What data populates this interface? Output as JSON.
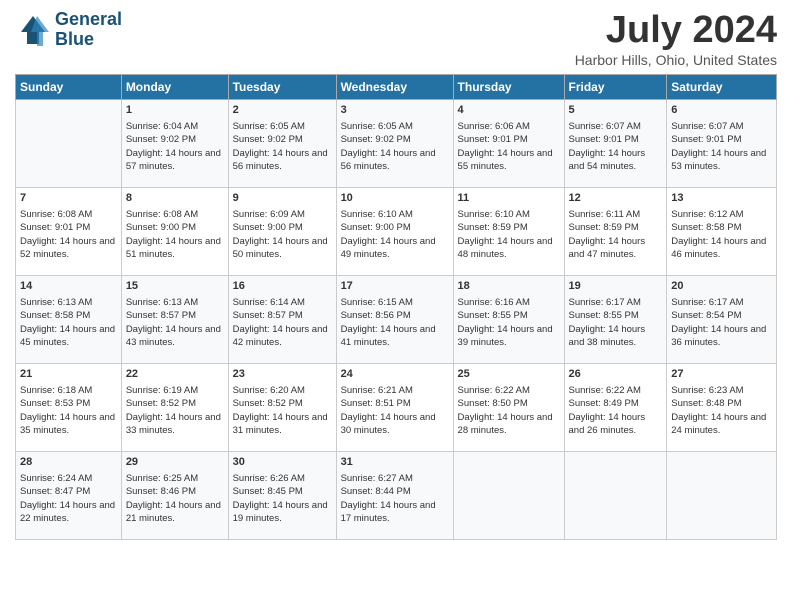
{
  "header": {
    "logo_line1": "General",
    "logo_line2": "Blue",
    "title": "July 2024",
    "location": "Harbor Hills, Ohio, United States"
  },
  "columns": [
    "Sunday",
    "Monday",
    "Tuesday",
    "Wednesday",
    "Thursday",
    "Friday",
    "Saturday"
  ],
  "weeks": [
    [
      {
        "day": "",
        "sunrise": "",
        "sunset": "",
        "daylight": ""
      },
      {
        "day": "1",
        "sunrise": "Sunrise: 6:04 AM",
        "sunset": "Sunset: 9:02 PM",
        "daylight": "Daylight: 14 hours and 57 minutes."
      },
      {
        "day": "2",
        "sunrise": "Sunrise: 6:05 AM",
        "sunset": "Sunset: 9:02 PM",
        "daylight": "Daylight: 14 hours and 56 minutes."
      },
      {
        "day": "3",
        "sunrise": "Sunrise: 6:05 AM",
        "sunset": "Sunset: 9:02 PM",
        "daylight": "Daylight: 14 hours and 56 minutes."
      },
      {
        "day": "4",
        "sunrise": "Sunrise: 6:06 AM",
        "sunset": "Sunset: 9:01 PM",
        "daylight": "Daylight: 14 hours and 55 minutes."
      },
      {
        "day": "5",
        "sunrise": "Sunrise: 6:07 AM",
        "sunset": "Sunset: 9:01 PM",
        "daylight": "Daylight: 14 hours and 54 minutes."
      },
      {
        "day": "6",
        "sunrise": "Sunrise: 6:07 AM",
        "sunset": "Sunset: 9:01 PM",
        "daylight": "Daylight: 14 hours and 53 minutes."
      }
    ],
    [
      {
        "day": "7",
        "sunrise": "Sunrise: 6:08 AM",
        "sunset": "Sunset: 9:01 PM",
        "daylight": "Daylight: 14 hours and 52 minutes."
      },
      {
        "day": "8",
        "sunrise": "Sunrise: 6:08 AM",
        "sunset": "Sunset: 9:00 PM",
        "daylight": "Daylight: 14 hours and 51 minutes."
      },
      {
        "day": "9",
        "sunrise": "Sunrise: 6:09 AM",
        "sunset": "Sunset: 9:00 PM",
        "daylight": "Daylight: 14 hours and 50 minutes."
      },
      {
        "day": "10",
        "sunrise": "Sunrise: 6:10 AM",
        "sunset": "Sunset: 9:00 PM",
        "daylight": "Daylight: 14 hours and 49 minutes."
      },
      {
        "day": "11",
        "sunrise": "Sunrise: 6:10 AM",
        "sunset": "Sunset: 8:59 PM",
        "daylight": "Daylight: 14 hours and 48 minutes."
      },
      {
        "day": "12",
        "sunrise": "Sunrise: 6:11 AM",
        "sunset": "Sunset: 8:59 PM",
        "daylight": "Daylight: 14 hours and 47 minutes."
      },
      {
        "day": "13",
        "sunrise": "Sunrise: 6:12 AM",
        "sunset": "Sunset: 8:58 PM",
        "daylight": "Daylight: 14 hours and 46 minutes."
      }
    ],
    [
      {
        "day": "14",
        "sunrise": "Sunrise: 6:13 AM",
        "sunset": "Sunset: 8:58 PM",
        "daylight": "Daylight: 14 hours and 45 minutes."
      },
      {
        "day": "15",
        "sunrise": "Sunrise: 6:13 AM",
        "sunset": "Sunset: 8:57 PM",
        "daylight": "Daylight: 14 hours and 43 minutes."
      },
      {
        "day": "16",
        "sunrise": "Sunrise: 6:14 AM",
        "sunset": "Sunset: 8:57 PM",
        "daylight": "Daylight: 14 hours and 42 minutes."
      },
      {
        "day": "17",
        "sunrise": "Sunrise: 6:15 AM",
        "sunset": "Sunset: 8:56 PM",
        "daylight": "Daylight: 14 hours and 41 minutes."
      },
      {
        "day": "18",
        "sunrise": "Sunrise: 6:16 AM",
        "sunset": "Sunset: 8:55 PM",
        "daylight": "Daylight: 14 hours and 39 minutes."
      },
      {
        "day": "19",
        "sunrise": "Sunrise: 6:17 AM",
        "sunset": "Sunset: 8:55 PM",
        "daylight": "Daylight: 14 hours and 38 minutes."
      },
      {
        "day": "20",
        "sunrise": "Sunrise: 6:17 AM",
        "sunset": "Sunset: 8:54 PM",
        "daylight": "Daylight: 14 hours and 36 minutes."
      }
    ],
    [
      {
        "day": "21",
        "sunrise": "Sunrise: 6:18 AM",
        "sunset": "Sunset: 8:53 PM",
        "daylight": "Daylight: 14 hours and 35 minutes."
      },
      {
        "day": "22",
        "sunrise": "Sunrise: 6:19 AM",
        "sunset": "Sunset: 8:52 PM",
        "daylight": "Daylight: 14 hours and 33 minutes."
      },
      {
        "day": "23",
        "sunrise": "Sunrise: 6:20 AM",
        "sunset": "Sunset: 8:52 PM",
        "daylight": "Daylight: 14 hours and 31 minutes."
      },
      {
        "day": "24",
        "sunrise": "Sunrise: 6:21 AM",
        "sunset": "Sunset: 8:51 PM",
        "daylight": "Daylight: 14 hours and 30 minutes."
      },
      {
        "day": "25",
        "sunrise": "Sunrise: 6:22 AM",
        "sunset": "Sunset: 8:50 PM",
        "daylight": "Daylight: 14 hours and 28 minutes."
      },
      {
        "day": "26",
        "sunrise": "Sunrise: 6:22 AM",
        "sunset": "Sunset: 8:49 PM",
        "daylight": "Daylight: 14 hours and 26 minutes."
      },
      {
        "day": "27",
        "sunrise": "Sunrise: 6:23 AM",
        "sunset": "Sunset: 8:48 PM",
        "daylight": "Daylight: 14 hours and 24 minutes."
      }
    ],
    [
      {
        "day": "28",
        "sunrise": "Sunrise: 6:24 AM",
        "sunset": "Sunset: 8:47 PM",
        "daylight": "Daylight: 14 hours and 22 minutes."
      },
      {
        "day": "29",
        "sunrise": "Sunrise: 6:25 AM",
        "sunset": "Sunset: 8:46 PM",
        "daylight": "Daylight: 14 hours and 21 minutes."
      },
      {
        "day": "30",
        "sunrise": "Sunrise: 6:26 AM",
        "sunset": "Sunset: 8:45 PM",
        "daylight": "Daylight: 14 hours and 19 minutes."
      },
      {
        "day": "31",
        "sunrise": "Sunrise: 6:27 AM",
        "sunset": "Sunset: 8:44 PM",
        "daylight": "Daylight: 14 hours and 17 minutes."
      },
      {
        "day": "",
        "sunrise": "",
        "sunset": "",
        "daylight": ""
      },
      {
        "day": "",
        "sunrise": "",
        "sunset": "",
        "daylight": ""
      },
      {
        "day": "",
        "sunrise": "",
        "sunset": "",
        "daylight": ""
      }
    ]
  ]
}
